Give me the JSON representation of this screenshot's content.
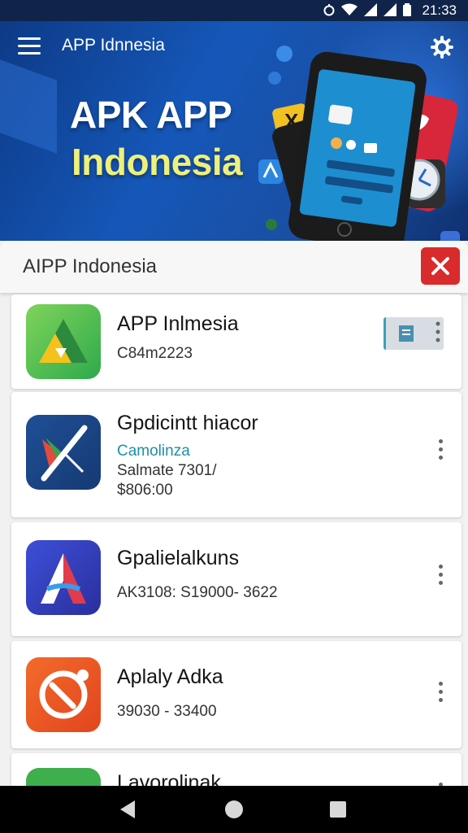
{
  "status_bar": {
    "time": "21:33"
  },
  "header": {
    "title": "APP Idnnesia"
  },
  "hero": {
    "line1": "APK APP",
    "line2": "Indonesia"
  },
  "search": {
    "value": "AIPP Indonesia"
  },
  "apps": [
    {
      "name": "APP Inlmesia",
      "sub1": "C84m2223",
      "sub2": "",
      "sub3": "",
      "action": "install-chip"
    },
    {
      "name": "Gpdicintt hiacor",
      "sub1": "Camolinza",
      "sub2": "Salmate 7301/",
      "sub3": "$806:00",
      "action": "kebab"
    },
    {
      "name": "Gpalielalkuns",
      "sub1": "AK3108: S19000- 3622",
      "sub2": "",
      "sub3": "",
      "action": "kebab"
    },
    {
      "name": "Aplaly Adka",
      "sub1": "39030 - 33400",
      "sub2": "",
      "sub3": "",
      "action": "kebab"
    },
    {
      "name": "Lavorolinak",
      "sub1": "",
      "sub2": "",
      "sub3": "",
      "action": "kebab"
    }
  ],
  "icons": {
    "menu": "menu-icon",
    "settings": "gear-icon",
    "close": "close-icon",
    "nav_back": "back-icon",
    "nav_home": "home-icon",
    "nav_recent": "recents-icon"
  },
  "colors": {
    "hero_bg": "#1557b8",
    "hero_accent_text": "#eef07a",
    "close_button": "#d92b2b",
    "secondary_text_accent": "#1f8ea8"
  }
}
